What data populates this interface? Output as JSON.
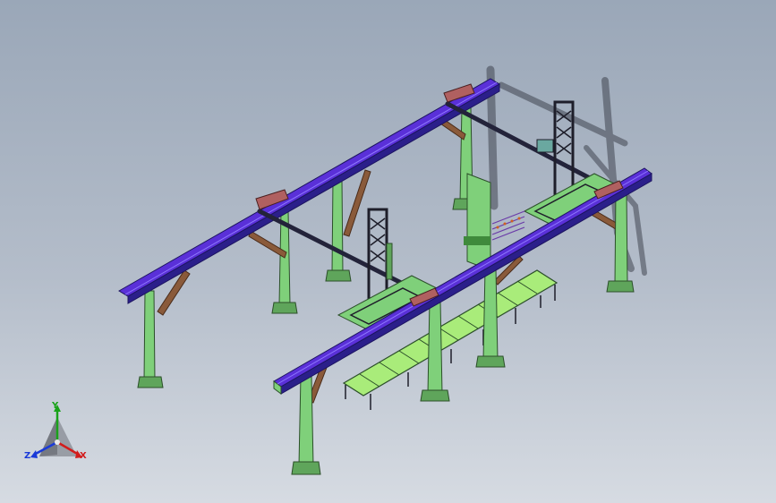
{
  "triad": {
    "x_label": "X",
    "y_label": "Y",
    "z_label": "Z",
    "x_color": "#d21c1c",
    "y_color": "#1aa21a",
    "z_color": "#1a3ad8"
  },
  "colors": {
    "beam_top": "#5a30d8",
    "beam_side": "#2b1f8a",
    "column": "#7fd07a",
    "column_dark": "#3f8a3c",
    "brace": "#8a5a3a",
    "conveyor": "#a9ec7a",
    "crossbar": "#23233a"
  }
}
